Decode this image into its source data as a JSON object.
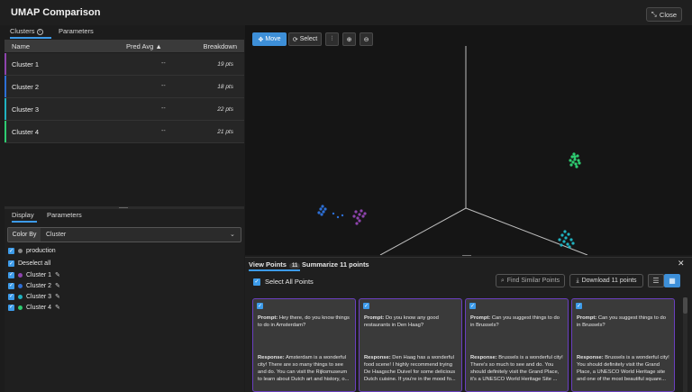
{
  "window": {
    "title": "UMAP Comparison",
    "close_label": "Close"
  },
  "left_tabs": {
    "clusters": "Clusters",
    "parameters": "Parameters"
  },
  "table": {
    "headers": {
      "name": "Name",
      "pred_avg": "Pred Avg",
      "breakdown": "Breakdown"
    },
    "rows": [
      {
        "name": "Cluster 1",
        "pred_avg": "--",
        "pts": "19 pts",
        "color": "#8e44ad"
      },
      {
        "name": "Cluster 2",
        "pred_avg": "--",
        "pts": "18 pts",
        "color": "#2d6fd6"
      },
      {
        "name": "Cluster 3",
        "pred_avg": "--",
        "pts": "22 pts",
        "color": "#20b2c0"
      },
      {
        "name": "Cluster 4",
        "pred_avg": "--",
        "pts": "21 pts",
        "color": "#2ecc71"
      }
    ]
  },
  "lower_tabs": {
    "display": "Display",
    "parameters": "Parameters"
  },
  "color_by": {
    "label": "Color By",
    "value": "Cluster"
  },
  "legend": {
    "dataset": "production",
    "deselect": "Deselect all",
    "clusters": [
      "Cluster 1",
      "Cluster 2",
      "Cluster 3",
      "Cluster 4"
    ]
  },
  "toolbar": {
    "move": "Move",
    "select": "Select"
  },
  "bottom": {
    "view_points": "View Points",
    "count": "11",
    "summarize": "Summarize 11 points",
    "select_all": "Select All Points",
    "find_similar": "Find Similar Points",
    "download": "Download 11 points"
  },
  "cards": [
    {
      "prompt_label": "Prompt:",
      "prompt": "Hey there, do you know things to do in Amsterdam?",
      "response_label": "Response:",
      "response": "Amsterdam is a wonderful city! There are so many things to see and do. You can visit the Rijksmuseum to learn about Dutch art and history, o..."
    },
    {
      "prompt_label": "Prompt:",
      "prompt": "Do you know any good restaurants in Den Haag?",
      "response_label": "Response:",
      "response": "Den Haag has a wonderful food scene! I highly recommend trying De Haagsche Duivel for some delicious Dutch cuisine. If you're in the mood fo..."
    },
    {
      "prompt_label": "Prompt:",
      "prompt": "Can you suggest things to do in Brussels?",
      "response_label": "Response:",
      "response": "Brussels is a wonderful city! There's so much to see and do. You should definitely visit the Grand Place, it's a UNESCO World Heritage Site ..."
    },
    {
      "prompt_label": "Prompt:",
      "prompt": "Can you suggest things to do in Brussels?",
      "response_label": "Response:",
      "response": "Brussels is a wonderful city! You should definitely visit the Grand Place, a UNESCO World Heritage site and one of the most beautiful square..."
    }
  ]
}
